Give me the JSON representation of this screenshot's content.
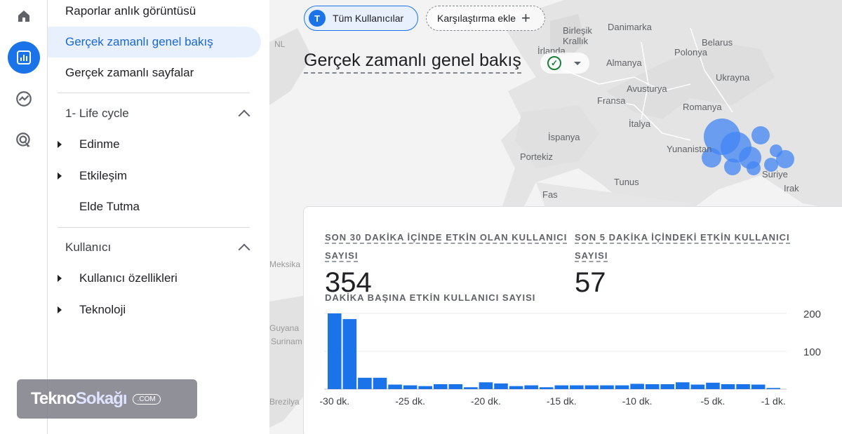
{
  "rail": {
    "items": [
      {
        "icon": "home-icon",
        "active": false
      },
      {
        "icon": "reports-icon",
        "active": true
      },
      {
        "icon": "explore-icon",
        "active": false
      },
      {
        "icon": "advertising-icon",
        "active": false
      }
    ]
  },
  "nav": {
    "snapshot": "Raporlar anlık görüntüsü",
    "realtime_overview": "Gerçek zamanlı genel bakış",
    "realtime_pages": "Gerçek zamanlı sayfalar",
    "lifecycle": {
      "title": "1- Life cycle",
      "items": [
        "Edinme",
        "Etkileşim",
        "Elde Tutma"
      ]
    },
    "user": {
      "title": "Kullanıcı",
      "items": [
        "Kullanıcı özellikleri",
        "Teknoloji"
      ]
    }
  },
  "header": {
    "audience_chip": "Tüm Kullanıcılar",
    "audience_initial": "T",
    "compare_chip": "Karşılaştırma ekle",
    "title": "Gerçek zamanlı genel bakış"
  },
  "map_labels": [
    "Birleşik Krallık",
    "Danimarka",
    "İrlanda",
    "Belarus",
    "Polonya",
    "Almanya",
    "Ukrayna",
    "Avusturya",
    "Fransa",
    "Romanya",
    "İtalya",
    "İspanya",
    "Portekiz",
    "Yunanistan",
    "Tunus",
    "Suriye",
    "Irak",
    "Fas",
    "NL",
    "Guyana",
    "Surinam",
    "Brezilya",
    "Meksika"
  ],
  "metrics": {
    "m30_label": "SON 30 DAKİKA İÇİNDE ETKİN OLAN KULLANICI SAYISI",
    "m30_value": "354",
    "m5_label": "SON 5 DAKİKA İÇİNDEKİ ETKİN KULLANICI SAYISI",
    "m5_value": "57"
  },
  "chart_data": {
    "type": "bar",
    "title": "DAKİKA BAŞINA ETKİN KULLANICI SAYISI",
    "x_tick_labels": [
      "-30 dk.",
      "-25 dk.",
      "-20 dk.",
      "-15 dk.",
      "-10 dk.",
      "-5 dk.",
      "-1 dk."
    ],
    "y_tick_labels": [
      "200",
      "100"
    ],
    "ylim": [
      0,
      200
    ],
    "values": [
      200,
      185,
      30,
      30,
      12,
      10,
      8,
      13,
      13,
      5,
      18,
      15,
      8,
      10,
      5,
      10,
      10,
      10,
      10,
      10,
      14,
      13,
      13,
      18,
      12,
      17,
      13,
      13,
      12,
      3
    ],
    "color": "#1a73e8"
  },
  "watermark": {
    "part1": "Tekno",
    "part2": "Sokağı",
    "suffix": ".COM"
  }
}
